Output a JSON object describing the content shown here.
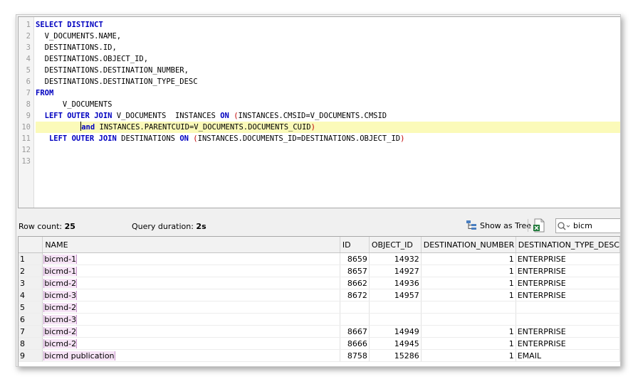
{
  "editor": {
    "lines": [
      {
        "n": "1",
        "code": [
          {
            "t": "kw",
            "v": "SELECT DISTINCT"
          }
        ]
      },
      {
        "n": "2",
        "code": [
          {
            "t": "p",
            "v": "  V_DOCUMENTS.NAME,"
          }
        ]
      },
      {
        "n": "3",
        "code": [
          {
            "t": "p",
            "v": "  DESTINATIONS.ID,"
          }
        ]
      },
      {
        "n": "4",
        "code": [
          {
            "t": "p",
            "v": "  DESTINATIONS.OBJECT_ID,"
          }
        ]
      },
      {
        "n": "5",
        "code": [
          {
            "t": "p",
            "v": "  DESTINATIONS.DESTINATION_NUMBER,"
          }
        ]
      },
      {
        "n": "6",
        "code": [
          {
            "t": "p",
            "v": "  DESTINATIONS.DESTINATION_TYPE_DESC"
          }
        ]
      },
      {
        "n": "7",
        "code": [
          {
            "t": "kw",
            "v": "FROM"
          }
        ]
      },
      {
        "n": "8",
        "code": [
          {
            "t": "p",
            "v": "      V_DOCUMENTS"
          }
        ]
      },
      {
        "n": "9",
        "code": [
          {
            "t": "p",
            "v": "  "
          },
          {
            "t": "kw",
            "v": "LEFT OUTER JOIN"
          },
          {
            "t": "p",
            "v": " V_DOCUMENTS  INSTANCES "
          },
          {
            "t": "kw",
            "v": "ON"
          },
          {
            "t": "p",
            "v": " "
          },
          {
            "t": "par",
            "v": "("
          },
          {
            "t": "p",
            "v": "INSTANCES.CMSID=V_DOCUMENTS.CMSID"
          }
        ]
      },
      {
        "n": "10",
        "highlight": true,
        "code": [
          {
            "t": "p",
            "v": "          "
          },
          {
            "t": "cursor",
            "v": ""
          },
          {
            "t": "kw",
            "v": "and"
          },
          {
            "t": "p",
            "v": " INSTANCES.PARENTCUID=V_DOCUMENTS.DOCUMENTS_CUID"
          },
          {
            "t": "par",
            "v": ")"
          }
        ]
      },
      {
        "n": "11",
        "code": [
          {
            "t": "p",
            "v": "   "
          },
          {
            "t": "kw",
            "v": "LEFT OUTER JOIN"
          },
          {
            "t": "p",
            "v": " DESTINATIONS "
          },
          {
            "t": "kw",
            "v": "ON"
          },
          {
            "t": "p",
            "v": " "
          },
          {
            "t": "par",
            "v": "("
          },
          {
            "t": "p",
            "v": "INSTANCES.DOCUMENTS_ID=DESTINATIONS.OBJECT_ID"
          },
          {
            "t": "par",
            "v": ")"
          }
        ]
      },
      {
        "n": "12",
        "code": []
      },
      {
        "n": "13",
        "code": []
      }
    ]
  },
  "status": {
    "row_count_label": "Row count:",
    "row_count": "25",
    "duration_label": "Query duration:",
    "duration": "2s"
  },
  "toolbar": {
    "show_tree_label": "Show as Tree",
    "search_value": "bicm"
  },
  "grid": {
    "columns": [
      "",
      "NAME",
      "ID",
      "OBJECT_ID",
      "DESTINATION_NUMBER",
      "DESTINATION_TYPE_DESC"
    ],
    "rows": [
      [
        "1",
        "bicmd-1",
        "8659",
        "14932",
        "1",
        "ENTERPRISE"
      ],
      [
        "2",
        "bicmd-1",
        "8657",
        "14927",
        "1",
        "ENTERPRISE"
      ],
      [
        "3",
        "bicmd-2",
        "8662",
        "14936",
        "1",
        "ENTERPRISE"
      ],
      [
        "4",
        "bicmd-3",
        "8672",
        "14957",
        "1",
        "ENTERPRISE"
      ],
      [
        "5",
        "bicmd-2",
        "",
        "",
        "",
        ""
      ],
      [
        "6",
        "bicmd-3",
        "",
        "",
        "",
        ""
      ],
      [
        "7",
        "bicmd-2",
        "8667",
        "14949",
        "1",
        "ENTERPRISE"
      ],
      [
        "8",
        "bicmd-2",
        "8666",
        "14945",
        "1",
        "ENTERPRISE"
      ],
      [
        "9",
        "bicmd publication",
        "8758",
        "15286",
        "1",
        "EMAIL"
      ]
    ]
  },
  "colors": {
    "keyword": "#0000c0",
    "paren": "#c00000",
    "line_highlight": "#fbfab9",
    "name_highlight": "#f6e3f6"
  }
}
